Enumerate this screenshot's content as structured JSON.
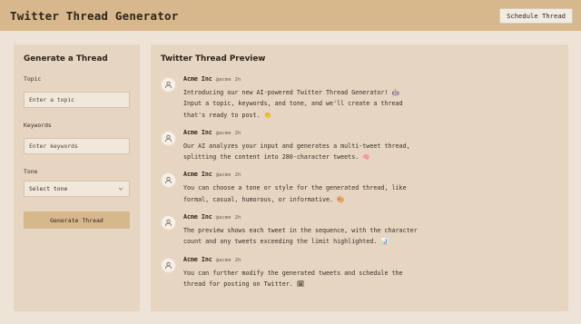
{
  "header": {
    "title": "Twitter Thread Generator",
    "schedule_button": "Schedule Thread"
  },
  "form": {
    "title": "Generate a Thread",
    "topic_label": "Topic",
    "topic_placeholder": "Enter a topic",
    "keywords_label": "Keywords",
    "keywords_placeholder": "Enter keywords",
    "tone_label": "Tone",
    "tone_value": "Select tone",
    "generate_button": "Generate Thread"
  },
  "preview": {
    "title": "Twitter Thread Preview",
    "tweets": [
      {
        "author": "Acme Inc",
        "handle": "@acme",
        "time": "2h",
        "text": "Introducing our new AI-powered Twitter Thread Generator! 🤖\nInput a topic, keywords, and tone, and we'll create a thread\nthat's ready to post. 👏"
      },
      {
        "author": "Acme Inc",
        "handle": "@acme",
        "time": "2h",
        "text": "Our AI analyzes your input and generates a multi-tweet thread,\nsplitting the content into 280-character tweets. 🧠"
      },
      {
        "author": "Acme Inc",
        "handle": "@acme",
        "time": "2h",
        "text": "You can choose a tone or style for the generated thread, like\nformal, casual, humorous, or informative. 🎨"
      },
      {
        "author": "Acme Inc",
        "handle": "@acme",
        "time": "2h",
        "text": "The preview shows each tweet in the sequence, with the character\ncount and any tweets exceeding the limit highlighted. 📊"
      },
      {
        "author": "Acme Inc",
        "handle": "@acme",
        "time": "2h",
        "text": "You can further modify the generated tweets and schedule the\nthread for posting on Twitter. 🗓"
      }
    ]
  },
  "icons": {
    "avatar": "user-icon",
    "select_arrow": "chevron-down-icon"
  },
  "colors": {
    "header_bg": "#d6b88c",
    "page_bg": "#ede3d6",
    "panel_bg": "#e5d5c1",
    "button_bg": "#d6b88c"
  }
}
